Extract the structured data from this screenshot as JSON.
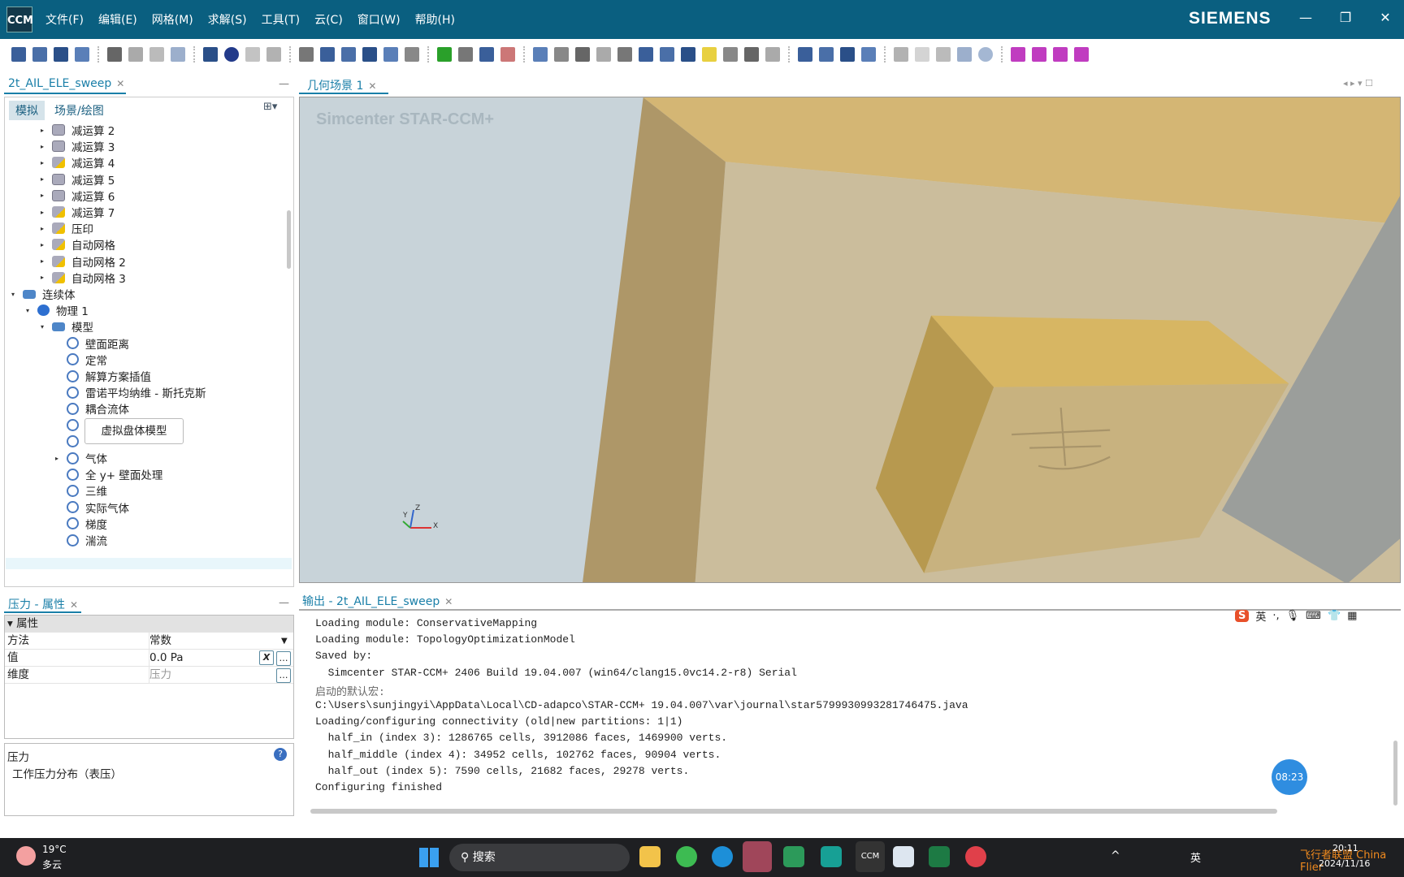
{
  "app": {
    "logo": "CCM",
    "brand": "SIEMENS",
    "menu": [
      "文件(F)",
      "编辑(E)",
      "网格(M)",
      "求解(S)",
      "工具(T)",
      "云(C)",
      "窗口(W)",
      "帮助(H)"
    ],
    "window_controls": [
      "minimize",
      "restore",
      "close"
    ]
  },
  "toolbar": {
    "icons": [
      "new-sim",
      "open",
      "save",
      "save-as",
      "|",
      "copy",
      "paste",
      "undo",
      "redo",
      "|",
      "run",
      "record",
      "pause",
      "stop",
      "|",
      "geometry",
      "filter",
      "mesh",
      "delete-mesh",
      "surface",
      "volume",
      "|",
      "flag",
      "step",
      "run-step",
      "stop-red",
      "|",
      "scene",
      "fit",
      "zoom-box",
      "select",
      "camera",
      "back",
      "forward",
      "view-3d",
      "plane",
      "ruler",
      "grid",
      "table",
      "|",
      "plot",
      "table2",
      "select2",
      "light",
      "|",
      "play",
      "stop2",
      "prev",
      "next",
      "circle",
      "|",
      "part-a",
      "part-b",
      "part-c",
      "part-d"
    ]
  },
  "left": {
    "tab": "2t_AIL_ELE_sweep",
    "subtabs": [
      "模拟",
      "场景/绘图"
    ],
    "tree": [
      {
        "label": "减运算 2",
        "icon": "cube",
        "level": 2,
        "arrow": "▸"
      },
      {
        "label": "减运算 3",
        "icon": "cube",
        "level": 2,
        "arrow": "▸"
      },
      {
        "label": "减运算 4",
        "icon": "warn",
        "level": 2,
        "arrow": "▸"
      },
      {
        "label": "减运算 5",
        "icon": "cube",
        "level": 2,
        "arrow": "▸"
      },
      {
        "label": "减运算 6",
        "icon": "cube",
        "level": 2,
        "arrow": "▸"
      },
      {
        "label": "减运算 7",
        "icon": "warn",
        "level": 2,
        "arrow": "▸"
      },
      {
        "label": "压印",
        "icon": "warn",
        "level": 2,
        "arrow": "▸"
      },
      {
        "label": "自动网格",
        "icon": "warn",
        "level": 2,
        "arrow": "▸"
      },
      {
        "label": "自动网格 2",
        "icon": "warn",
        "level": 2,
        "arrow": "▸"
      },
      {
        "label": "自动网格 3",
        "icon": "warn",
        "level": 2,
        "arrow": "▸"
      },
      {
        "label": "连续体",
        "icon": "folder",
        "level": 0,
        "arrow": "▾"
      },
      {
        "label": "物理 1",
        "icon": "phys",
        "level": 1,
        "arrow": "▾"
      },
      {
        "label": "模型",
        "icon": "folder",
        "level": 2,
        "arrow": "▾"
      },
      {
        "label": "壁面距离",
        "icon": "model",
        "level": 3,
        "arrow": ""
      },
      {
        "label": "定常",
        "icon": "model",
        "level": 3,
        "arrow": ""
      },
      {
        "label": "解算方案插值",
        "icon": "model",
        "level": 3,
        "arrow": ""
      },
      {
        "label": "雷诺平均纳维 - 斯托克斯",
        "icon": "model",
        "level": 3,
        "arrow": ""
      },
      {
        "label": "耦合流体",
        "icon": "model",
        "level": 3,
        "arrow": ""
      },
      {
        "label": "",
        "icon": "model",
        "level": 3,
        "arrow": ""
      },
      {
        "label": "",
        "icon": "model",
        "level": 3,
        "arrow": ""
      },
      {
        "label": "气体",
        "icon": "model",
        "level": 3,
        "arrow": "▸"
      },
      {
        "label": "全 y+ 壁面处理",
        "icon": "model",
        "level": 3,
        "arrow": ""
      },
      {
        "label": "三维",
        "icon": "model",
        "level": 3,
        "arrow": ""
      },
      {
        "label": "实际气体",
        "icon": "model",
        "level": 3,
        "arrow": ""
      },
      {
        "label": "梯度",
        "icon": "model",
        "level": 3,
        "arrow": ""
      },
      {
        "label": "湍流",
        "icon": "model",
        "level": 3,
        "arrow": ""
      }
    ],
    "tooltip": "虚拟盘体模型"
  },
  "properties": {
    "tab": "压力 - 属性",
    "section": "属性",
    "rows": [
      {
        "key": "方法",
        "value": "常数"
      },
      {
        "key": "值",
        "value": "0.0 Pa"
      },
      {
        "key": "维度",
        "value": "压力"
      }
    ],
    "desc_title": "压力",
    "desc_text": "工作压力分布（表压）"
  },
  "viewport": {
    "tab": "几何场景 1",
    "watermark": "Simcenter STAR-CCM+",
    "axes": {
      "x": "X",
      "y": "Y",
      "z": "Z"
    }
  },
  "output": {
    "tab": "输出 - 2t_AIL_ELE_sweep",
    "lines": [
      "Loading module: ConservativeMapping",
      "Loading module: TopologyOptimizationModel",
      "Saved by:",
      "  Simcenter STAR-CCM+ 2406 Build 19.04.007 (win64/clang15.0vc14.2-r8) Serial",
      "启动的默认宏:",
      "C:\\Users\\sunjingyi\\AppData\\Local\\CD-adapco\\STAR-CCM+ 19.04.007\\var\\journal\\star5799930993281746475.java",
      "Loading/configuring connectivity (old|new partitions: 1|1)",
      "  half_in (index 3): 1286765 cells, 3912086 faces, 1469900 verts.",
      "  half_middle (index 4): 34952 cells, 102762 faces, 90904 verts.",
      "  half_out (index 5): 7590 cells, 21682 faces, 29278 verts.",
      "Configuring finished"
    ]
  },
  "overlay": {
    "timer": "08:23",
    "ime": [
      "S",
      "英",
      "·,",
      "mic",
      "keyboard",
      "shirt",
      "grid"
    ]
  },
  "taskbar": {
    "weather_temp": "19°C",
    "weather_desc": "多云",
    "search": "搜索",
    "ime": "英",
    "time": "20:11",
    "date": "2024/11/16",
    "watermark": "飞行者联盟 China Flier"
  }
}
